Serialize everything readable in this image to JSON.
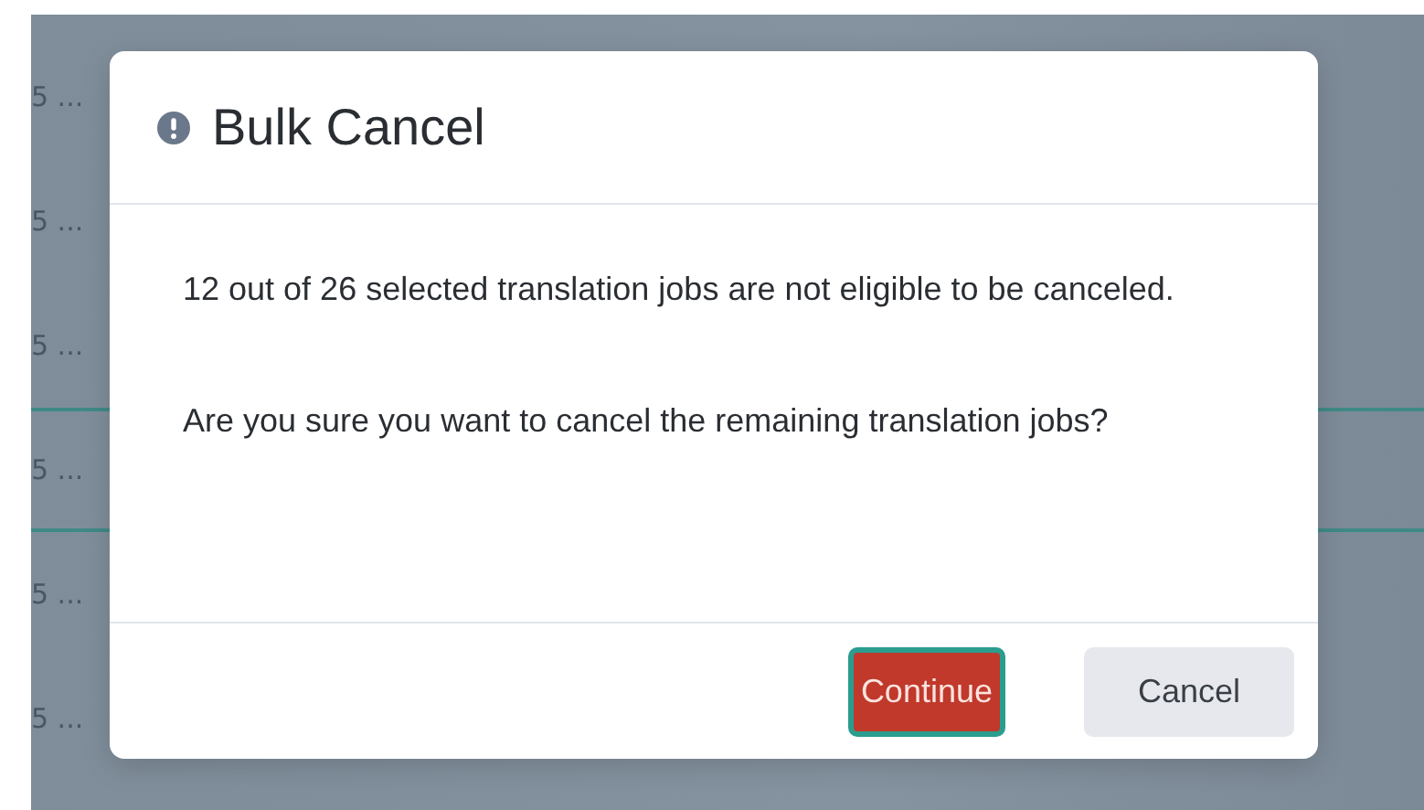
{
  "background_rows": [
    {
      "text": "5 ...",
      "selected": false
    },
    {
      "text": "5 ...",
      "selected": false
    },
    {
      "text": "5 ...",
      "selected": false
    },
    {
      "text": "5 ...",
      "selected": true
    },
    {
      "text": "5 ...",
      "selected": false
    },
    {
      "text": "5 ...",
      "selected": false
    }
  ],
  "dialog": {
    "title": "Bulk Cancel",
    "paragraphs": [
      "12 out of 26 selected translation jobs are not eligible to be canceled.",
      "Are you sure you want to cancel the remaining translation jobs?"
    ],
    "buttons": [
      {
        "label": "Continue",
        "kind": "primary"
      },
      {
        "label": "Cancel",
        "kind": "secondary"
      }
    ]
  }
}
